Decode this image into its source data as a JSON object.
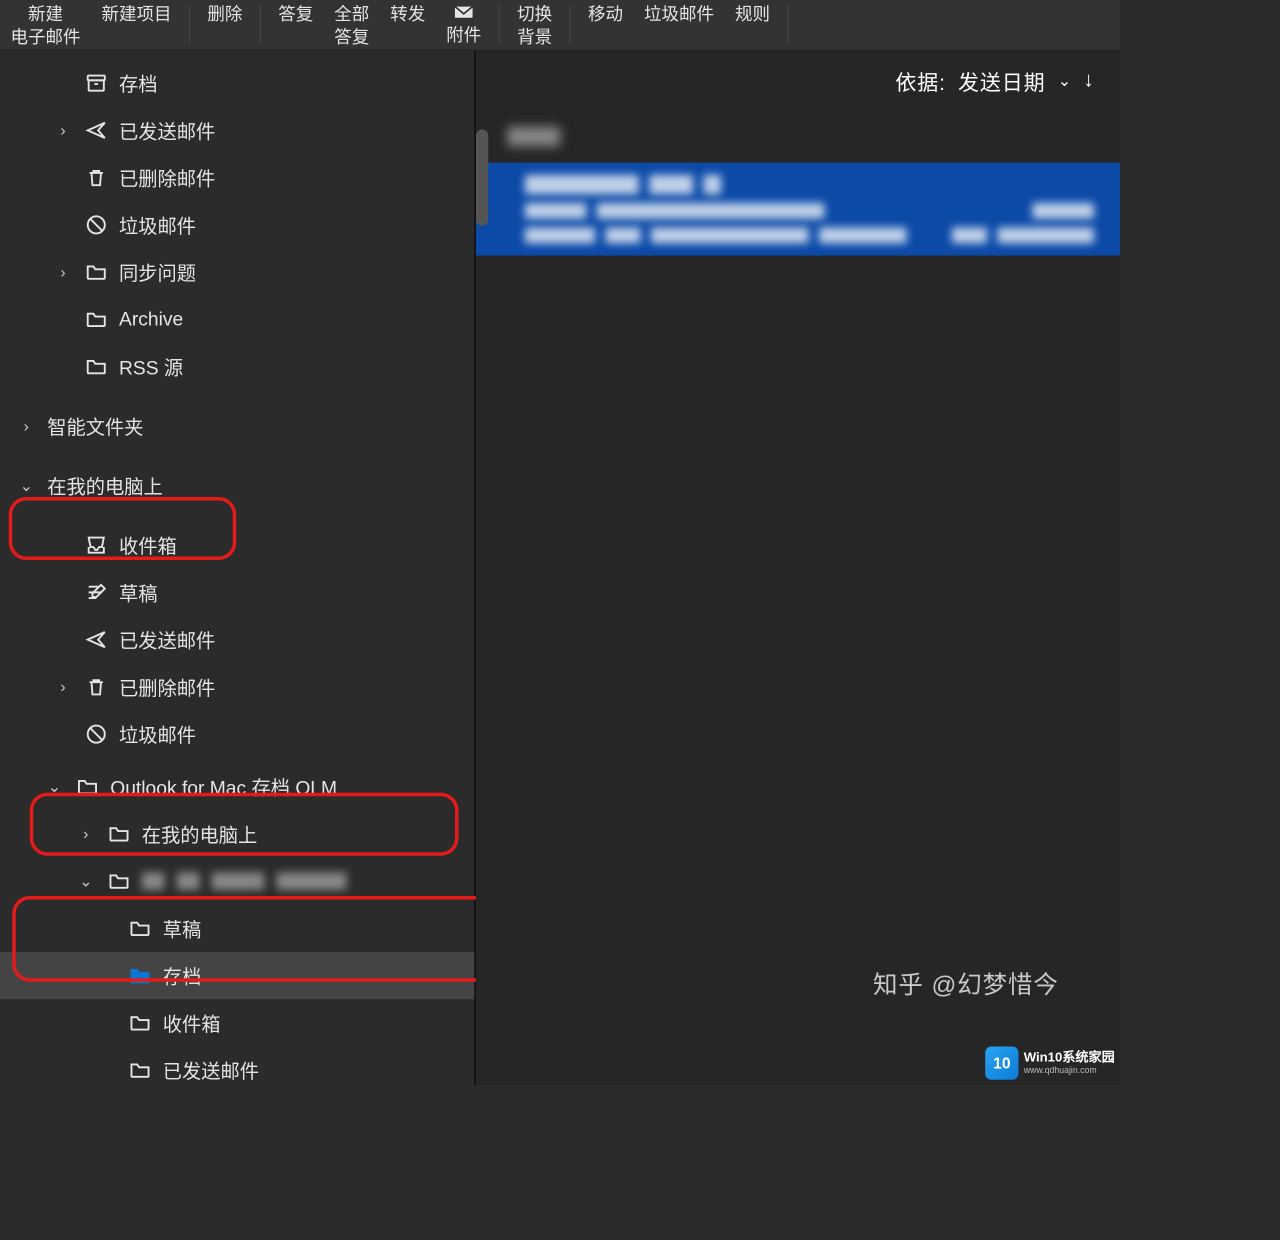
{
  "toolbar": {
    "new_mail_l1": "新建",
    "new_mail_l2": "电子邮件",
    "new_item": "新建项目",
    "delete": "删除",
    "reply": "答复",
    "reply_all_l1": "全部",
    "reply_all_l2": "答复",
    "forward": "转发",
    "attachment": "附件",
    "toggle_bg_l1": "切换",
    "toggle_bg_l2": "背景",
    "move": "移动",
    "junk": "垃圾邮件",
    "rules": "规则"
  },
  "sidebar": {
    "account": [
      {
        "label": "存档",
        "icon": "archive",
        "chev": ""
      },
      {
        "label": "已发送邮件",
        "icon": "send",
        "chev": ">"
      },
      {
        "label": "已删除邮件",
        "icon": "trash",
        "chev": ""
      },
      {
        "label": "垃圾邮件",
        "icon": "junk",
        "chev": ""
      },
      {
        "label": "同步问题",
        "icon": "folder",
        "chev": ">"
      },
      {
        "label": "Archive",
        "icon": "folder",
        "chev": ""
      },
      {
        "label": "RSS 源",
        "icon": "folder",
        "chev": ""
      }
    ],
    "smart_folders": "智能文件夹",
    "on_my_computer": "在我的电脑上",
    "local": [
      {
        "label": "收件箱",
        "icon": "inbox",
        "chev": ""
      },
      {
        "label": "草稿",
        "icon": "drafts",
        "chev": ""
      },
      {
        "label": "已发送邮件",
        "icon": "send",
        "chev": ""
      },
      {
        "label": "已删除邮件",
        "icon": "trash",
        "chev": ">"
      },
      {
        "label": "垃圾邮件",
        "icon": "junk",
        "chev": ""
      }
    ],
    "outlook_archive": "Outlook for Mac 存档 OLM",
    "archive_sub1": "在我的电脑上",
    "archive_blurred": "",
    "archive_deep": [
      {
        "label": "草稿",
        "icon": "folder"
      },
      {
        "label": "存档",
        "icon": "folder",
        "selected": true
      },
      {
        "label": "收件箱",
        "icon": "folder"
      },
      {
        "label": "已发送邮件",
        "icon": "folder"
      }
    ]
  },
  "sort": {
    "prefix": "依据:",
    "value": "发送日期"
  },
  "watermark1": "知乎 @幻梦惜今",
  "watermark2_t1": "Win10系统家园",
  "watermark2_t2": "www.qdhuajin.com",
  "watermark2_badge": "10"
}
